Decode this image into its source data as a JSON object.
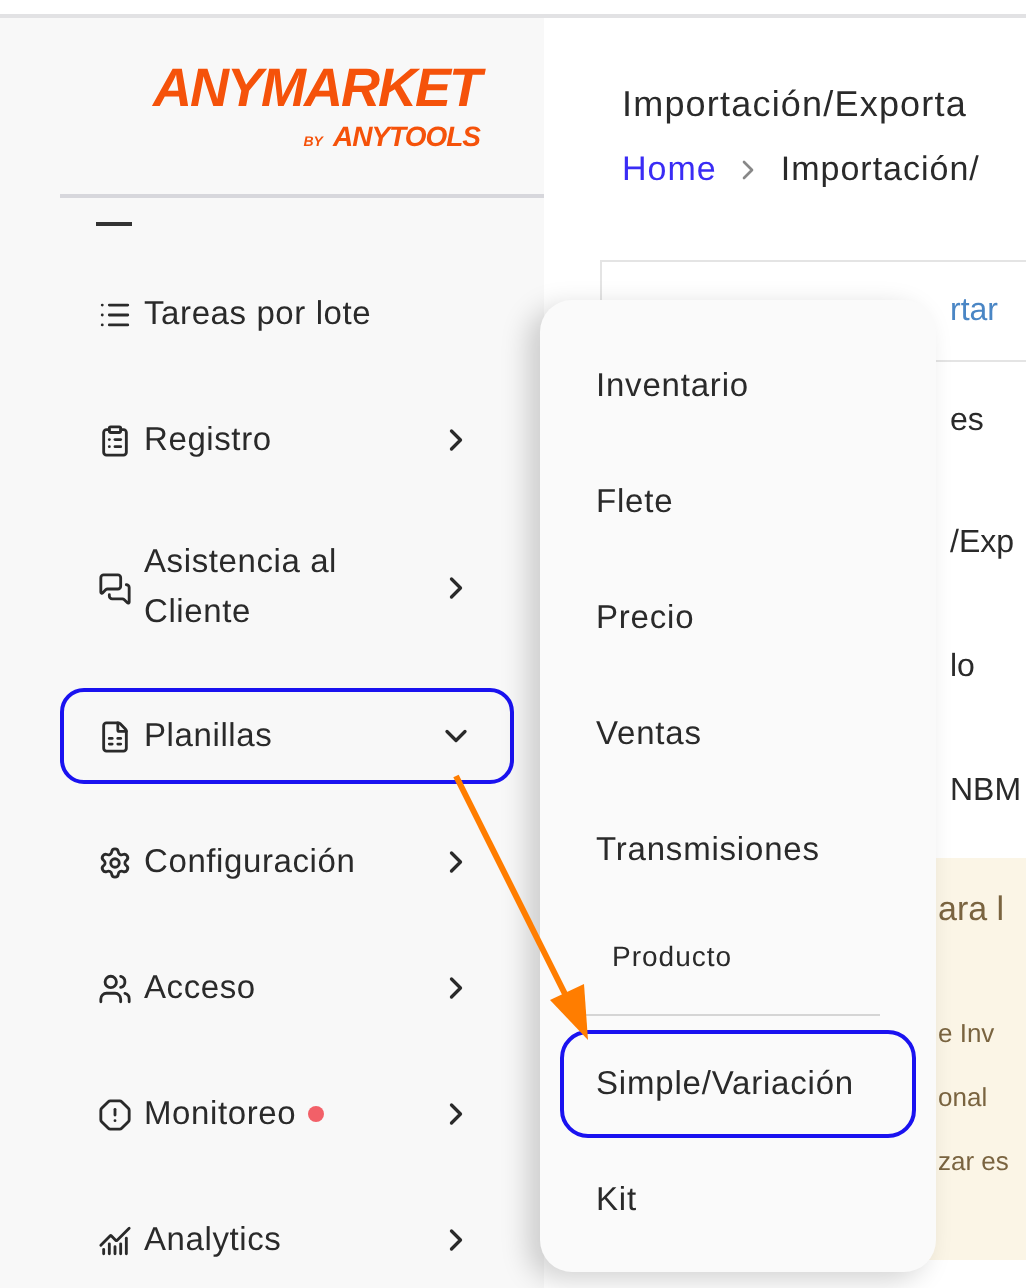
{
  "logo": {
    "name": "ANYMARKET",
    "by": "BY",
    "brand": "ANYTOOLS"
  },
  "header": {
    "title": "Importación/Exporta",
    "breadcrumb": [
      {
        "label": "Home",
        "link": true
      },
      {
        "label": "Importación/",
        "link": false
      }
    ]
  },
  "sidebar": {
    "items": [
      {
        "label": "Tareas por lote",
        "submenu": false,
        "highlighted": false,
        "alert": false
      },
      {
        "label": "Registro",
        "submenu": true,
        "expanded": false,
        "highlighted": false,
        "alert": false
      },
      {
        "label": "Asistencia al Cliente",
        "submenu": true,
        "expanded": false,
        "highlighted": false,
        "alert": false
      },
      {
        "label": "Planillas",
        "submenu": true,
        "expanded": true,
        "highlighted": true,
        "alert": false
      },
      {
        "label": "Configuración",
        "submenu": true,
        "expanded": false,
        "highlighted": false,
        "alert": false
      },
      {
        "label": "Acceso",
        "submenu": true,
        "expanded": false,
        "highlighted": false,
        "alert": false
      },
      {
        "label": "Monitoreo",
        "submenu": true,
        "expanded": false,
        "highlighted": false,
        "alert": true
      },
      {
        "label": "Analytics",
        "submenu": true,
        "expanded": false,
        "highlighted": false,
        "alert": false
      }
    ]
  },
  "submenu": {
    "items": [
      {
        "kind": "item",
        "label": "Inventario",
        "highlighted": false
      },
      {
        "kind": "item",
        "label": "Flete",
        "highlighted": false
      },
      {
        "kind": "item",
        "label": "Precio",
        "highlighted": false
      },
      {
        "kind": "item",
        "label": "Ventas",
        "highlighted": false
      },
      {
        "kind": "item",
        "label": "Transmisiones",
        "highlighted": false
      },
      {
        "kind": "header",
        "label": "Producto"
      },
      {
        "kind": "item",
        "label": "Simple/Variación",
        "highlighted": true
      },
      {
        "kind": "item",
        "label": "Kit",
        "highlighted": false
      }
    ]
  },
  "content": {
    "link": "rtar",
    "lines": [
      "es",
      "/Exp",
      "lo",
      "NBM"
    ],
    "notice": {
      "heading": "ara l",
      "lines": [
        "e Inv",
        "onal",
        "zar es"
      ]
    }
  }
}
